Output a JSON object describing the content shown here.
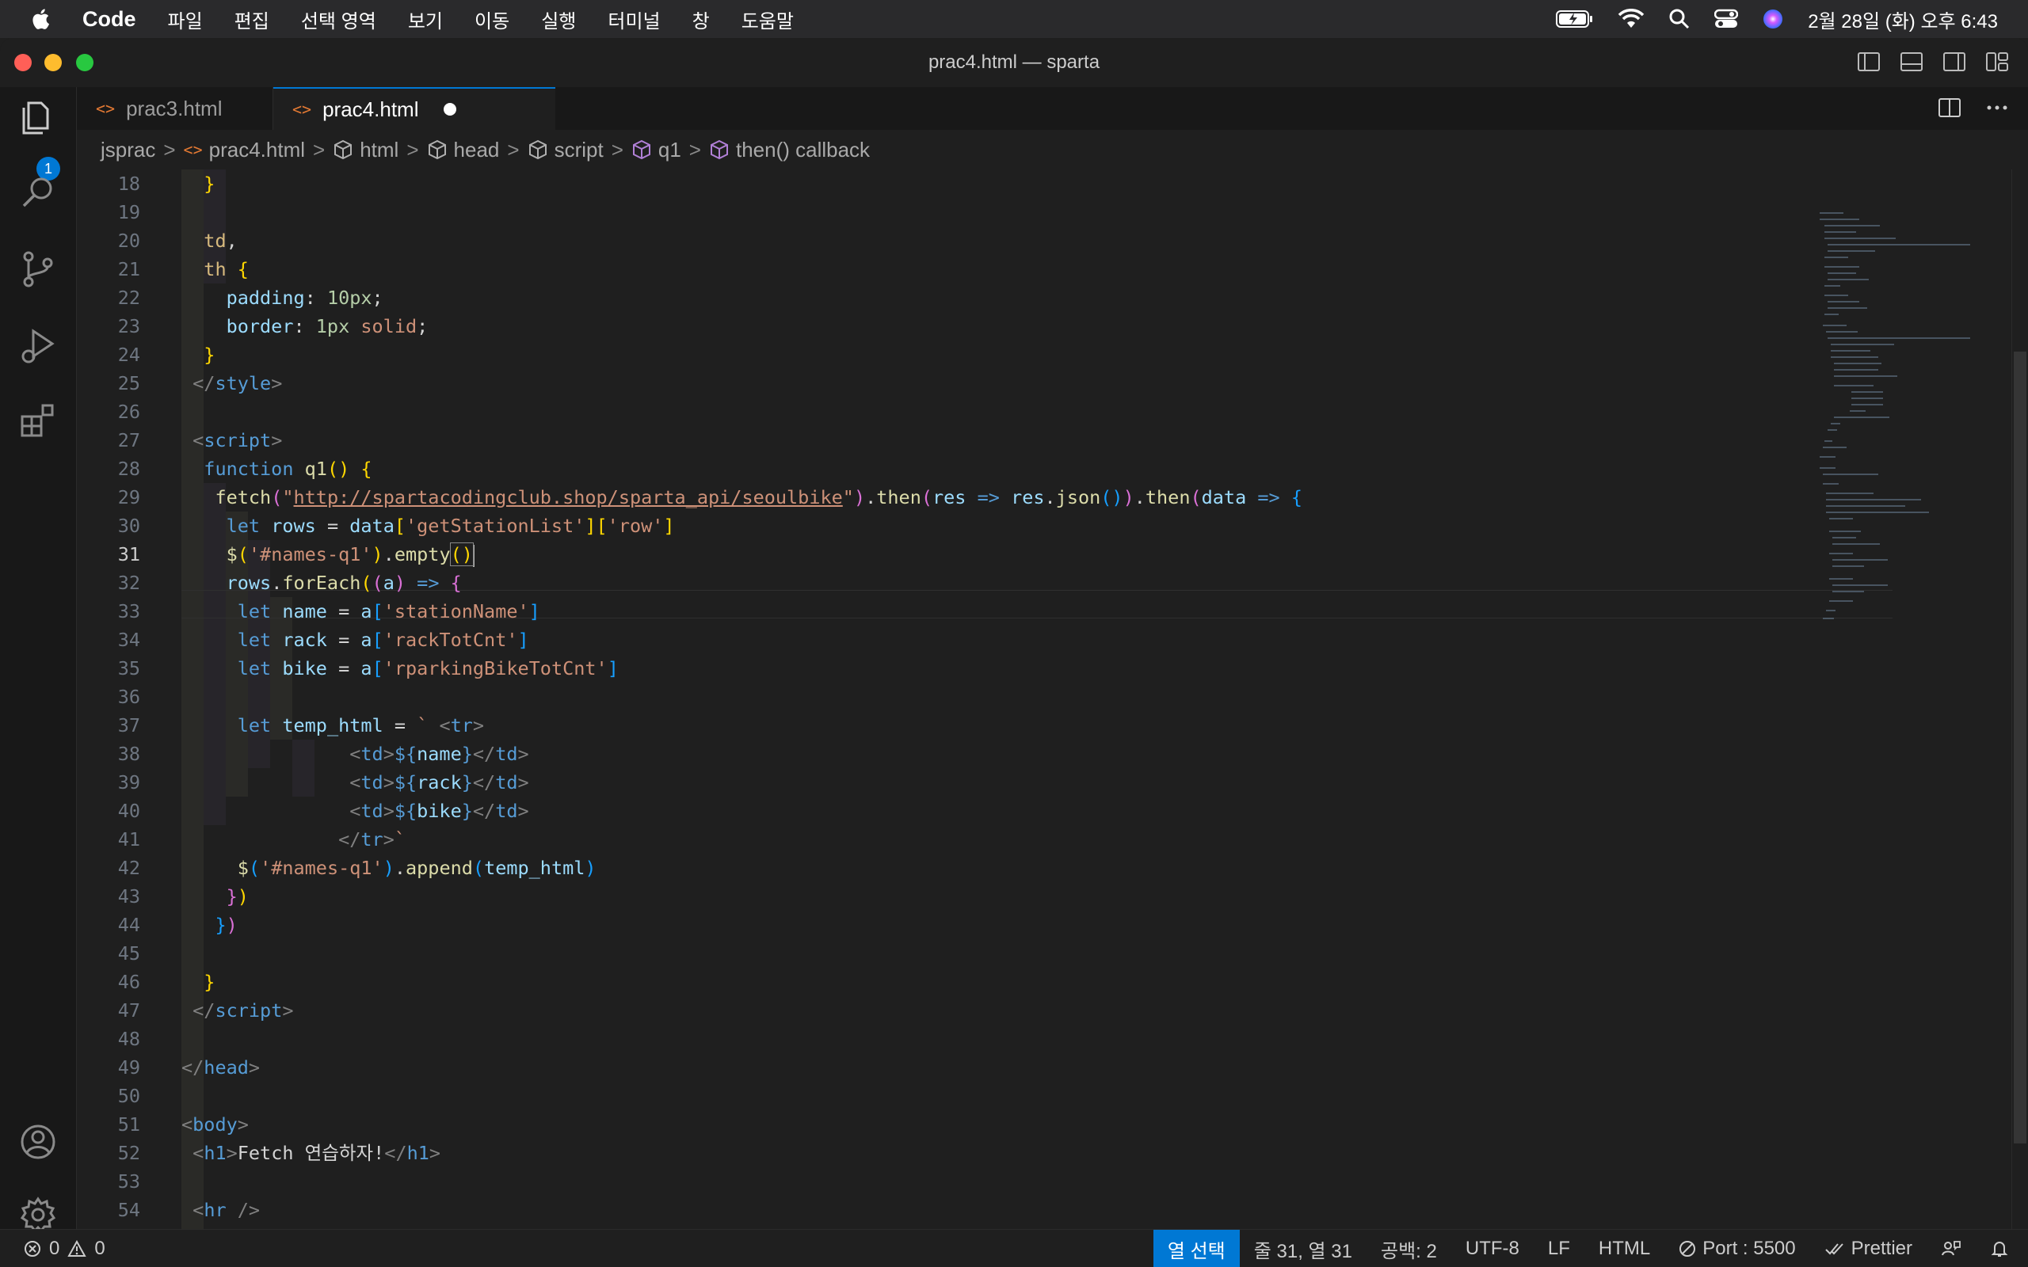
{
  "menubar": {
    "app_name": "Code",
    "menus": [
      "파일",
      "편집",
      "선택 영역",
      "보기",
      "이동",
      "실행",
      "터미널",
      "창",
      "도움말"
    ],
    "datetime": "2월 28일 (화) 오후 6:43"
  },
  "window": {
    "title": "prac4.html — sparta"
  },
  "activity_bar": {
    "explorer_badge": "1"
  },
  "tabs": [
    {
      "label": "prac3.html",
      "active": false
    },
    {
      "label": "prac4.html",
      "active": true,
      "dirty": true
    }
  ],
  "breadcrumb": [
    "jsprac",
    "prac4.html",
    "html",
    "head",
    "script",
    "q1",
    "then() callback"
  ],
  "editor": {
    "current_line": 31,
    "line_numbers": [
      "18",
      "19",
      "20",
      "21",
      "22",
      "23",
      "24",
      "25",
      "26",
      "27",
      "28",
      "29",
      "30",
      "31",
      "32",
      "33",
      "34",
      "35",
      "36",
      "37",
      "38",
      "39",
      "40",
      "41",
      "42",
      "43",
      "44",
      "45",
      "46",
      "47",
      "48",
      "49",
      "50",
      "51",
      "52",
      "53",
      "54"
    ]
  },
  "code_strings": {
    "url": "http://spartacodingclub.shop/sparta_api/seoulbike",
    "h1_text": "Fetch 연습하자!"
  },
  "statusbar": {
    "errors": "0",
    "warnings": "0",
    "selection_mode": "열 선택",
    "position": "줄 31, 열 31",
    "spaces": "공백: 2",
    "encoding": "UTF-8",
    "eol": "LF",
    "language": "HTML",
    "port": "Port : 5500",
    "formatter": "Prettier"
  }
}
